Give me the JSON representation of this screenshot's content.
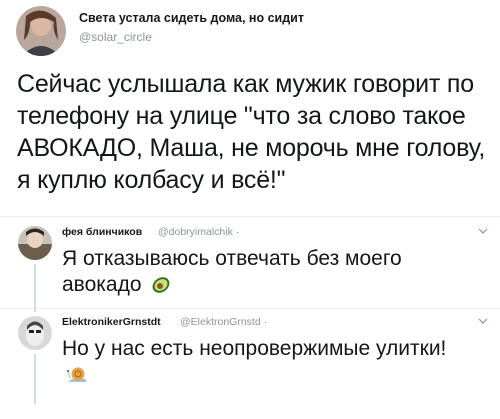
{
  "tweet": {
    "display_name": "Света устала сидеть дома, но сидит",
    "handle": "@solar_circle",
    "text": "Сейчас услышала как мужик говорит по телефону на улице \"что за слово такое АВОКАДО, Маша, не морочь мне голову, я куплю колбасу и всё!\""
  },
  "replies": [
    {
      "display_name": "фея блинчиков",
      "handle": "@dobryimalchik ·",
      "text": "Я отказываюсь отвечать без моего авокадо",
      "emoji_icon": "avocado-icon"
    },
    {
      "display_name": "ElektronikerGrnstdt",
      "handle": "@ElektronGrnstd ·",
      "text": "Но у нас есть  неопровержимые улитки!",
      "emoji_icon": "snail-icon"
    }
  ],
  "icons": {
    "menu": "chevron-down-icon"
  },
  "colors": {
    "divider": "#e6ecf0",
    "muted": "#8a949e",
    "text": "#14171a"
  }
}
